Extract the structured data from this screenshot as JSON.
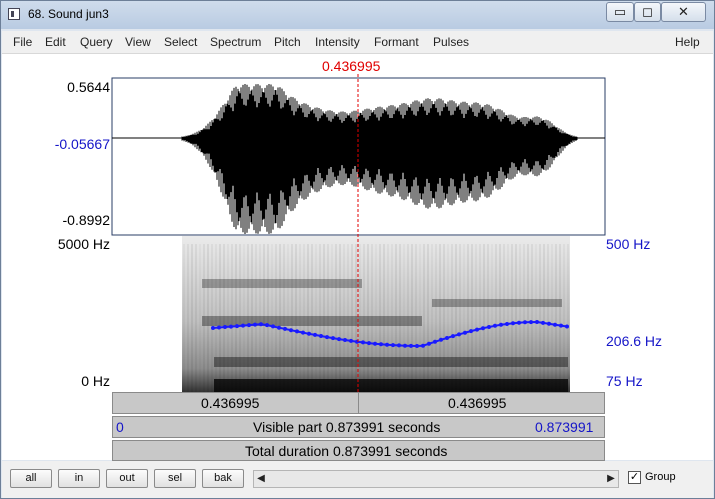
{
  "window": {
    "title": "68. Sound jun3",
    "controls": {
      "minimize": "▭",
      "maximize": "◻",
      "close": "✕"
    }
  },
  "menu": [
    "File",
    "Edit",
    "Query",
    "View",
    "Select",
    "Spectrum",
    "Pitch",
    "Intensity",
    "Formant",
    "Pulses"
  ],
  "help_label": "Help",
  "cursor": {
    "time_label": "0.436995"
  },
  "waveform": {
    "max_label": "0.5644",
    "zero_label": "-0.05667",
    "min_label": "-0.8992"
  },
  "spectrogram": {
    "top_label": "5000 Hz",
    "bottom_label": "0 Hz"
  },
  "pitch": {
    "top_label": "500 Hz",
    "mid_label": "206.6 Hz",
    "bottom_label": "75 Hz"
  },
  "bottom_panels": {
    "left_segment": "0.436995",
    "right_segment": "0.436995",
    "visible_start": "0",
    "visible_text": "Visible part 0.873991 seconds",
    "visible_end": "0.873991",
    "total_text": "Total duration 0.873991 seconds"
  },
  "buttons": {
    "all": "all",
    "in": "in",
    "out": "out",
    "sel": "sel",
    "bak": "bak"
  },
  "scroll": {
    "left_arrow": "◀",
    "right_arrow": "▶"
  },
  "group": {
    "label": "Group",
    "checked": "✓"
  },
  "colors": {
    "pitch_contour": "#1a1aff",
    "cursor": "#e00000",
    "axis_labels": "#1515c8"
  }
}
